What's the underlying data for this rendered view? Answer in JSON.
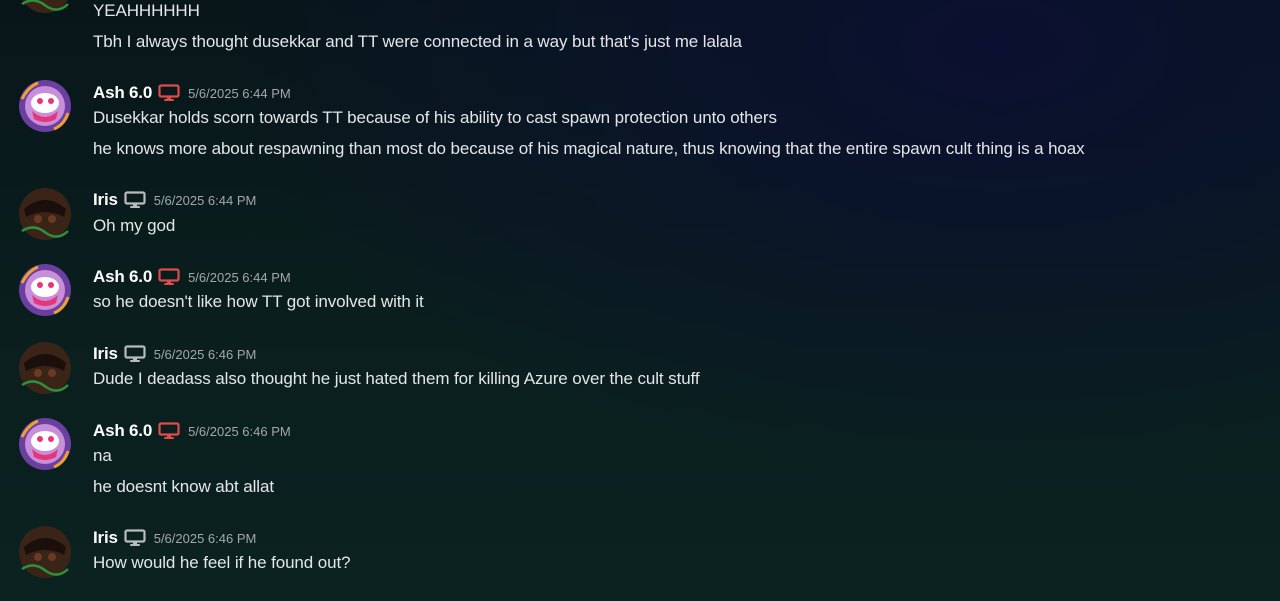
{
  "colors": {
    "ash_device_icon": "#e04b4b",
    "iris_device_icon": "#b9bbbe",
    "username": "#ffffff",
    "timestamp": "#a3a7ad",
    "message_text": "#e3e5e8"
  },
  "icons": {
    "device": "desktop-monitor-icon",
    "ash_avatar": "ash-avatar",
    "iris_avatar": "iris-avatar"
  },
  "partial": {
    "line1": "YEAHHHHHH",
    "line2": "Tbh I always thought dusekkar and TT were connected in a way but that's just me lalala"
  },
  "messages": [
    {
      "author": "Ash 6.0",
      "timestamp": "5/6/2025 6:44 PM",
      "lines": [
        "Dusekkar holds scorn towards TT because of his ability to cast spawn protection unto others",
        "he knows more about respawning than most do because of his magical nature, thus knowing that the entire spawn cult thing is a hoax"
      ]
    },
    {
      "author": "Iris",
      "timestamp": "5/6/2025 6:44 PM",
      "lines": [
        "Oh my god"
      ]
    },
    {
      "author": "Ash 6.0",
      "timestamp": "5/6/2025 6:44 PM",
      "lines": [
        "so he doesn't like how TT got involved with it"
      ]
    },
    {
      "author": "Iris",
      "timestamp": "5/6/2025 6:46 PM",
      "lines": [
        "Dude I deadass also thought he just hated them for killing Azure over the cult stuff"
      ]
    },
    {
      "author": "Ash 6.0",
      "timestamp": "5/6/2025 6:46 PM",
      "lines": [
        "na",
        "he doesnt know abt allat"
      ]
    },
    {
      "author": "Iris",
      "timestamp": "5/6/2025 6:46 PM",
      "lines": [
        "How would he feel if he found out?"
      ]
    }
  ]
}
